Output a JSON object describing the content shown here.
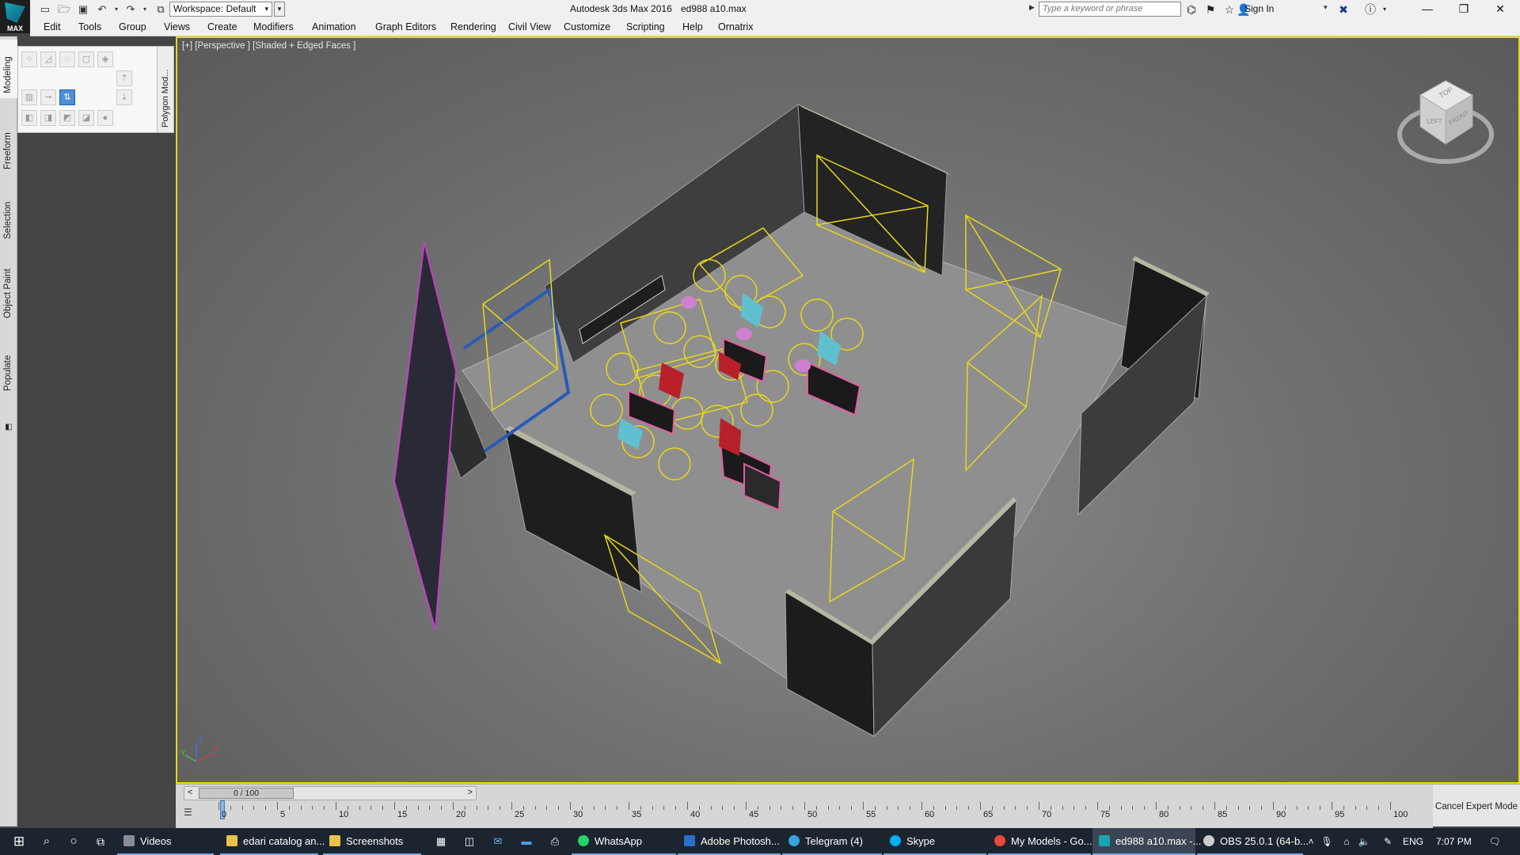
{
  "titlebar": {
    "workspace": "Workspace: Default",
    "app_title": "Autodesk 3ds Max 2016",
    "file_title": "ed988 a10.max",
    "search_placeholder": "Type a keyword or phrase",
    "sign_in": "Sign In",
    "logo_text": "MAX"
  },
  "menu": [
    "Edit",
    "Tools",
    "Group",
    "Views",
    "Create",
    "Modifiers",
    "Animation",
    "Graph Editors",
    "Rendering",
    "Civil View",
    "Customize",
    "Scripting",
    "Help",
    "Ornatrix"
  ],
  "left_tabs": [
    "Modeling",
    "Freeform",
    "Selection",
    "Object Paint",
    "Populate"
  ],
  "ribbon": {
    "panel_label": "Polygon Mod..."
  },
  "viewport": {
    "label": "[+] [Perspective ] [Shaded + Edged Faces ]",
    "viewcube_faces": [
      "TOP",
      "LEFT",
      "FRONT"
    ],
    "axes": [
      "X",
      "Y",
      "Z"
    ]
  },
  "timeline": {
    "frame_display": "0 / 100",
    "prev": "<",
    "next": ">",
    "ticks": [
      0,
      5,
      10,
      15,
      20,
      25,
      30,
      35,
      40,
      45,
      50,
      55,
      60,
      65,
      70,
      75,
      80,
      85,
      90,
      95,
      100
    ],
    "cancel_expert": "Cancel Expert Mode"
  },
  "taskbar": {
    "apps": [
      {
        "label": "Videos",
        "color": "#8a8a9a"
      },
      {
        "label": "edari catalog an...",
        "color": "#e8c250"
      },
      {
        "label": "Screenshots",
        "color": "#e8c250"
      },
      {
        "label": "WhatsApp",
        "color": "#25d366"
      },
      {
        "label": "Adobe Photosh...",
        "color": "#2a6fc9"
      },
      {
        "label": "Telegram (4)",
        "color": "#36a3df"
      },
      {
        "label": "Skype",
        "color": "#00aff0"
      },
      {
        "label": "My Models - Go...",
        "color": "#e84a3a"
      },
      {
        "label": "ed988 a10.max -...",
        "color": "#1aa3b5"
      },
      {
        "label": "OBS 25.0.1 (64-b...",
        "color": "#ccc"
      }
    ],
    "language": "ENG",
    "time": "7:07 PM"
  },
  "colors": {
    "viewport_border": "#e8d81a",
    "accent": "#1aa3b5"
  }
}
